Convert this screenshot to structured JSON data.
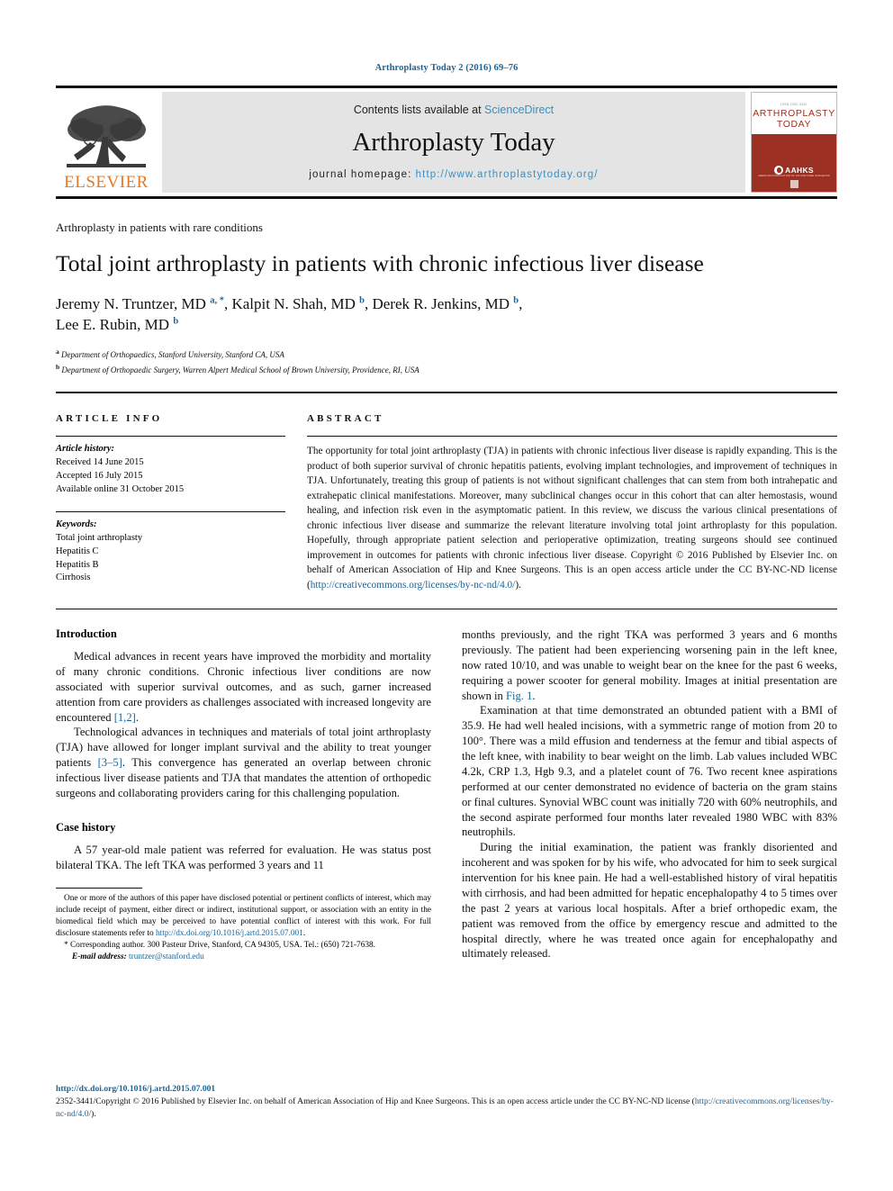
{
  "running_head": "Arthroplasty Today 2 (2016) 69–76",
  "header": {
    "publisher_name": "ELSEVIER",
    "contents_prefix": "Contents lists available at ",
    "contents_link": "ScienceDirect",
    "journal_title": "Arthroplasty Today",
    "homepage_label": "journal homepage: ",
    "homepage_url": "http://www.arthroplastytoday.org/",
    "cover": {
      "kicker": "ISSN 2352-3441",
      "line1": "ARTHROPLASTY",
      "line2": "TODAY",
      "society": "AAHKS",
      "society_sub": "AMERICAN ASSOCIATION OF HIP AND KNEE SURGEONS"
    },
    "accent_link_color": "#3a8fc4",
    "elsevier_orange": "#e87722",
    "cover_red": "#9b2f21"
  },
  "article": {
    "kicker": "Arthroplasty in patients with rare conditions",
    "title": "Total joint arthroplasty in patients with chronic infectious liver disease",
    "authors_line1_a": "Jeremy N. Truntzer, MD ",
    "authors_sup1": "a, *",
    "authors_line1_b": ", Kalpit N. Shah, MD ",
    "authors_sup2": "b",
    "authors_line1_c": ", Derek R. Jenkins, MD ",
    "authors_sup3": "b",
    "authors_line1_d": ",",
    "authors_line2_a": "Lee E. Rubin, MD ",
    "authors_sup4": "b",
    "affiliation_a_sup": "a",
    "affiliation_a": " Department of Orthopaedics, Stanford University, Stanford CA, USA",
    "affiliation_b_sup": "b",
    "affiliation_b": " Department of Orthopaedic Surgery, Warren Alpert Medical School of Brown University, Providence, RI, USA"
  },
  "article_info": {
    "heading": "ARTICLE INFO",
    "history_label": "Article history:",
    "history": [
      "Received 14 June 2015",
      "Accepted 16 July 2015",
      "Available online 31 October 2015"
    ],
    "keywords_label": "Keywords:",
    "keywords": [
      "Total joint arthroplasty",
      "Hepatitis C",
      "Hepatitis B",
      "Cirrhosis"
    ]
  },
  "abstract": {
    "heading": "ABSTRACT",
    "body": "The opportunity for total joint arthroplasty (TJA) in patients with chronic infectious liver disease is rapidly expanding. This is the product of both superior survival of chronic hepatitis patients, evolving implant technologies, and improvement of techniques in TJA. Unfortunately, treating this group of patients is not without significant challenges that can stem from both intrahepatic and extrahepatic clinical manifestations. Moreover, many subclinical changes occur in this cohort that can alter hemostasis, wound healing, and infection risk even in the asymptomatic patient. In this review, we discuss the various clinical presentations of chronic infectious liver disease and summarize the relevant literature involving total joint arthroplasty for this population. Hopefully, through appropriate patient selection and perioperative optimization, treating surgeons should see continued improvement in outcomes for patients with chronic infectious liver disease.",
    "copyright": "Copyright © 2016 Published by Elsevier Inc. on behalf of American Association of Hip and Knee Surgeons. This is an open access article under the CC BY-NC-ND license (",
    "license_url": "http://creativecommons.org/licenses/by-nc-nd/4.0/",
    "copyright_tail": ")."
  },
  "body": {
    "left": {
      "intro_heading": "Introduction",
      "intro_p1_a": "Medical advances in recent years have improved the morbidity and mortality of many chronic conditions. Chronic infectious liver conditions are now associated with superior survival outcomes, and as such, garner increased attention from care providers as challenges associated with increased longevity are encountered ",
      "intro_p1_ref": "[1,2]",
      "intro_p1_b": ".",
      "intro_p2_a": "Technological advances in techniques and materials of total joint arthroplasty (TJA) have allowed for longer implant survival and the ability to treat younger patients ",
      "intro_p2_ref": "[3–5]",
      "intro_p2_b": ". This convergence has generated an overlap between chronic infectious liver disease patients and TJA that mandates the attention of orthopedic surgeons and collaborating providers caring for this challenging population.",
      "case_heading": "Case history",
      "case_p1": "A 57 year-old male patient was referred for evaluation. He was status post bilateral TKA. The left TKA was performed 3 years and 11"
    },
    "right": {
      "cont_p1_a": "months previously, and the right TKA was performed 3 years and 6 months previously. The patient had been experiencing worsening pain in the left knee, now rated 10/10, and was unable to weight bear on the knee for the past 6 weeks, requiring a power scooter for general mobility. Images at initial presentation are shown in ",
      "cont_p1_ref": "Fig. 1",
      "cont_p1_b": ".",
      "p2": "Examination at that time demonstrated an obtunded patient with a BMI of 35.9. He had well healed incisions, with a symmetric range of motion from 20 to 100°. There was a mild effusion and tenderness at the femur and tibial aspects of the left knee, with inability to bear weight on the limb. Lab values included WBC 4.2k, CRP 1.3, Hgb 9.3, and a platelet count of 76. Two recent knee aspirations performed at our center demonstrated no evidence of bacteria on the gram stains or final cultures. Synovial WBC count was initially 720 with 60% neutrophils, and the second aspirate performed four months later revealed 1980 WBC with 83% neutrophils.",
      "p3": "During the initial examination, the patient was frankly disoriented and incoherent and was spoken for by his wife, who advocated for him to seek surgical intervention for his knee pain. He had a well-established history of viral hepatitis with cirrhosis, and had been admitted for hepatic encephalopathy 4 to 5 times over the past 2 years at various local hospitals. After a brief orthopedic exam, the patient was removed from the office by emergency rescue and admitted to the hospital directly, where he was treated once again for encephalopathy and ultimately released."
    }
  },
  "footnote": {
    "conflict_a": "One or more of the authors of this paper have disclosed potential or pertinent conflicts of interest, which may include receipt of payment, either direct or indirect, institutional support, or association with an entity in the biomedical field which may be perceived to have potential conflict of interest with this work. For full disclosure statements refer to ",
    "conflict_url": "http://dx.doi.org/10.1016/j.artd.2015.07.001",
    "conflict_b": ".",
    "corresponding_marker": "*",
    "corresponding": " Corresponding author. 300 Pasteur Drive, Stanford, CA 94305, USA. Tel.: (650) 721-7638.",
    "email_label": "E-mail address:",
    "email": "truntzer@stanford.edu"
  },
  "doc_footer": {
    "doi": "http://dx.doi.org/10.1016/j.artd.2015.07.001",
    "copyright_a": "2352-3441/Copyright © 2016 Published by Elsevier Inc. on behalf of American Association of Hip and Knee Surgeons. This is an open access article under the CC BY-NC-ND license (",
    "license_url": "http://creativecommons.org/licenses/by-nc-nd/4.0/",
    "copyright_b": ")."
  }
}
